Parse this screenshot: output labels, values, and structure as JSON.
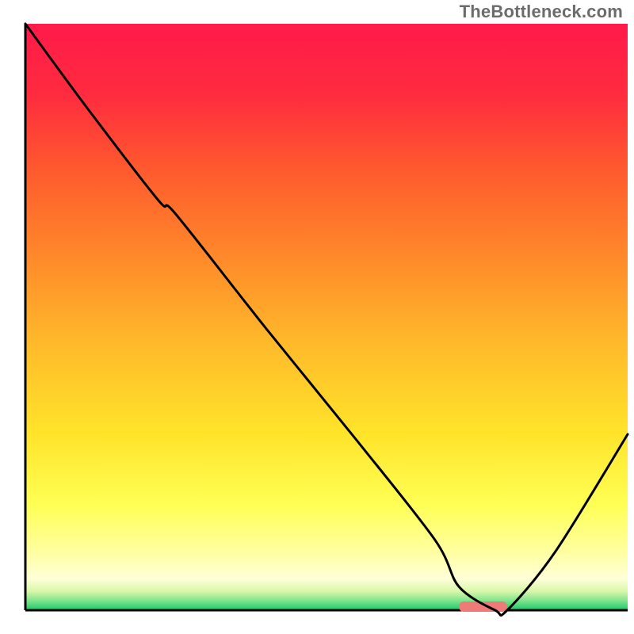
{
  "watermark": "TheBottleneck.com",
  "chart_data": {
    "type": "line",
    "title": "",
    "xlabel": "",
    "ylabel": "",
    "xlim": [
      0,
      100
    ],
    "ylim": [
      0,
      100
    ],
    "background_gradient": {
      "stops": [
        {
          "offset": 0.0,
          "color": "#ff1a4a"
        },
        {
          "offset": 0.12,
          "color": "#ff2b3f"
        },
        {
          "offset": 0.25,
          "color": "#ff5a2e"
        },
        {
          "offset": 0.4,
          "color": "#ff8a2a"
        },
        {
          "offset": 0.55,
          "color": "#ffbb2a"
        },
        {
          "offset": 0.7,
          "color": "#ffe42a"
        },
        {
          "offset": 0.82,
          "color": "#ffff55"
        },
        {
          "offset": 0.9,
          "color": "#ffffa0"
        },
        {
          "offset": 0.946,
          "color": "#ffffd8"
        },
        {
          "offset": 0.968,
          "color": "#d7f7a8"
        },
        {
          "offset": 0.984,
          "color": "#7de38b"
        },
        {
          "offset": 1.0,
          "color": "#17c96a"
        }
      ]
    },
    "series": [
      {
        "name": "bottleneck-curve",
        "x": [
          0.0,
          10.0,
          22.0,
          25.0,
          40.0,
          55.0,
          68.0,
          72.0,
          78.0,
          80.0,
          88.0,
          100.0
        ],
        "y": [
          100.0,
          86.0,
          70.0,
          67.5,
          48.0,
          29.0,
          12.0,
          4.0,
          0.0,
          0.0,
          10.0,
          30.0
        ]
      }
    ],
    "marker": {
      "name": "optimal-range",
      "x_start": 72.0,
      "x_end": 80.0,
      "y": 0.0,
      "color": "#ef7b78"
    },
    "axis": {
      "color": "#000000",
      "width": 3
    }
  }
}
